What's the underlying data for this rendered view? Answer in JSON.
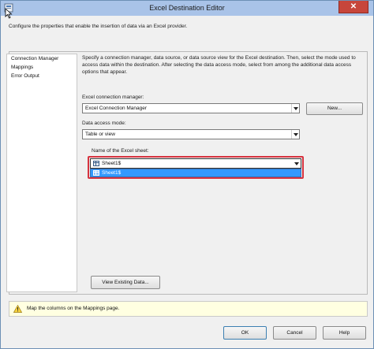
{
  "window": {
    "title": "Excel Destination Editor",
    "close_glyph": "✕"
  },
  "description": "Configure the properties that enable the insertion of data via an Excel provider.",
  "nav": {
    "items": [
      "Connection Manager",
      "Mappings",
      "Error Output"
    ],
    "selected": "Connection Manager"
  },
  "info_text": "Specify a connection manager, data source, or data source view for the Excel destination. Then, select the mode used to access data within the destination. After selecting the data access mode, select from among the additional data access options that appear.",
  "connection": {
    "label": "Excel connection manager:",
    "value": "Excel Connection Manager",
    "new_button": "New..."
  },
  "access_mode": {
    "label": "Data access mode:",
    "value": "Table or view"
  },
  "sheet": {
    "label": "Name of the Excel sheet:",
    "value": "Sheet1$",
    "options": [
      "Sheet1$"
    ],
    "highlight_color": "#d6333f",
    "selection_color": "#3399ff"
  },
  "view_data_button": "View Existing Data...",
  "warning": {
    "icon": "warning-icon",
    "text": "Map the columns on the Mappings page."
  },
  "footer": {
    "ok": "OK",
    "cancel": "Cancel",
    "help": "Help"
  }
}
